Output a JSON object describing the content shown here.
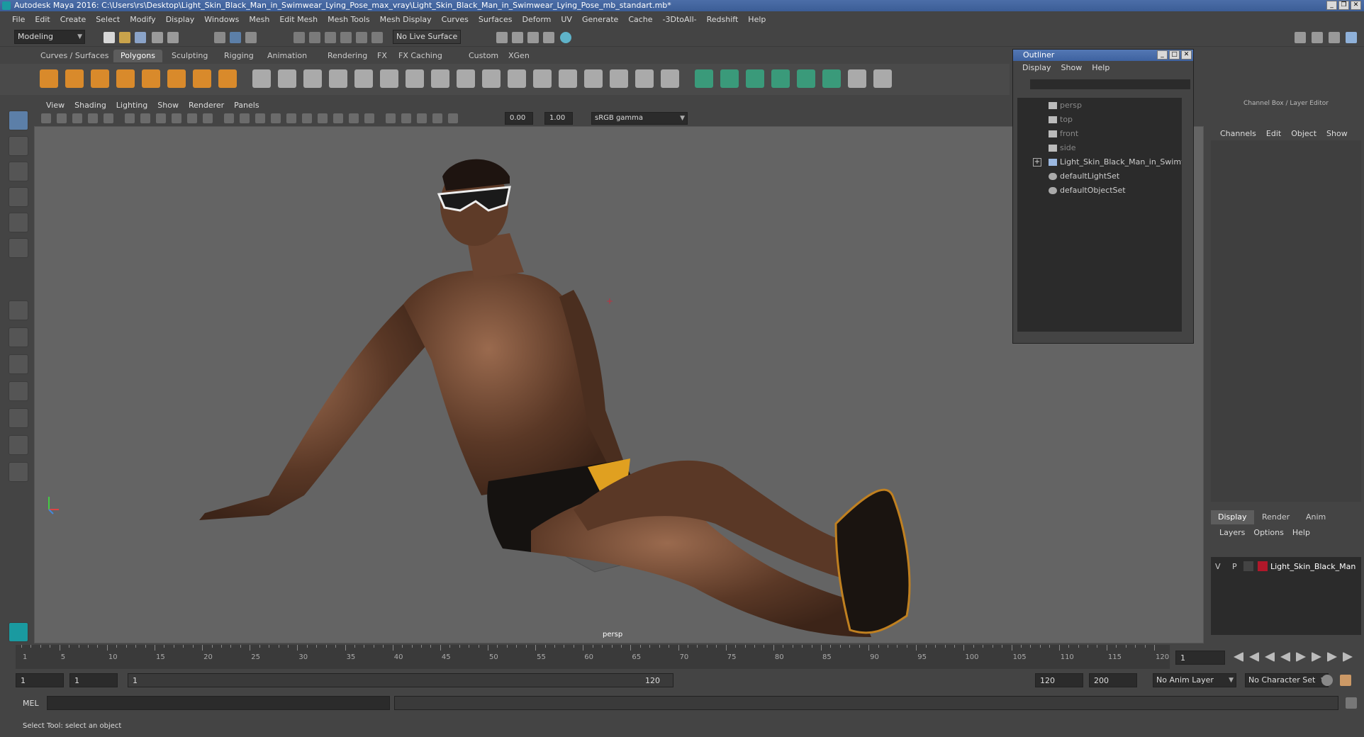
{
  "window": {
    "title": "Autodesk Maya 2016: C:\\Users\\rs\\Desktop\\Light_Skin_Black_Man_in_Swimwear_Lying_Pose_max_vray\\Light_Skin_Black_Man_in_Swimwear_Lying_Pose_mb_standart.mb*",
    "controls": [
      "_",
      "❐",
      "✕"
    ]
  },
  "menubar": [
    "File",
    "Edit",
    "Create",
    "Select",
    "Modify",
    "Display",
    "Windows",
    "Mesh",
    "Edit Mesh",
    "Mesh Tools",
    "Mesh Display",
    "Curves",
    "Surfaces",
    "Deform",
    "UV",
    "Generate",
    "Cache",
    "-3DtoAll-",
    "Redshift",
    "Help"
  ],
  "status": {
    "mode": "Modeling",
    "live_surface": "No Live Surface"
  },
  "shelf_tabs": [
    "Curves / Surfaces",
    "Polygons",
    "Sculpting",
    "Rigging",
    "Animation",
    "Rendering",
    "FX",
    "FX Caching",
    "Custom",
    "XGen"
  ],
  "shelf_active": "Polygons",
  "viewport": {
    "menu": [
      "View",
      "Shading",
      "Lighting",
      "Show",
      "Renderer",
      "Panels"
    ],
    "exposure": "0.00",
    "gamma": "1.00",
    "color_space": "sRGB gamma",
    "camera_label": "persp"
  },
  "outliner": {
    "title": "Outliner",
    "menu": [
      "Display",
      "Show",
      "Help"
    ],
    "items": [
      {
        "label": "persp",
        "icon": "camera-icon",
        "dim": true
      },
      {
        "label": "top",
        "icon": "camera-icon",
        "dim": true
      },
      {
        "label": "front",
        "icon": "camera-icon",
        "dim": true
      },
      {
        "label": "side",
        "icon": "camera-icon",
        "dim": true
      },
      {
        "label": "Light_Skin_Black_Man_in_Swimw",
        "icon": "group-icon",
        "dim": false,
        "expandable": true
      },
      {
        "label": "defaultLightSet",
        "icon": "set-icon",
        "dim": false
      },
      {
        "label": "defaultObjectSet",
        "icon": "set-icon",
        "dim": false
      }
    ]
  },
  "channelbox": {
    "title": "Channel Box / Layer Editor",
    "menu": [
      "Channels",
      "Edit",
      "Object",
      "Show"
    ],
    "layer_tabs": [
      "Display",
      "Render",
      "Anim"
    ],
    "layer_active": "Display",
    "layer_menu": [
      "Layers",
      "Options",
      "Help"
    ],
    "layer": {
      "v": "V",
      "p": "P",
      "name": "Light_Skin_Black_Man",
      "color": "#b0182a"
    }
  },
  "timeline": {
    "labels": [
      "1",
      "5",
      "10",
      "15",
      "20",
      "25",
      "30",
      "35",
      "40",
      "45",
      "50",
      "55",
      "60",
      "65",
      "70",
      "75",
      "80",
      "85",
      "90",
      "95",
      "100",
      "105",
      "110",
      "115",
      "120"
    ],
    "current_frame": "1"
  },
  "range": {
    "start": "1",
    "start_inner": "1",
    "slider_start": "1",
    "slider_end": "120",
    "end": "120",
    "end_outer": "200",
    "anim_layer": "No Anim Layer",
    "character_set": "No Character Set"
  },
  "cmdline": {
    "label": "MEL"
  },
  "helpline": {
    "text": "Select Tool: select an object"
  },
  "colors": {
    "accent": "#5c7fa8",
    "title": "#3b5d96",
    "viewport_bg": "#646464"
  }
}
